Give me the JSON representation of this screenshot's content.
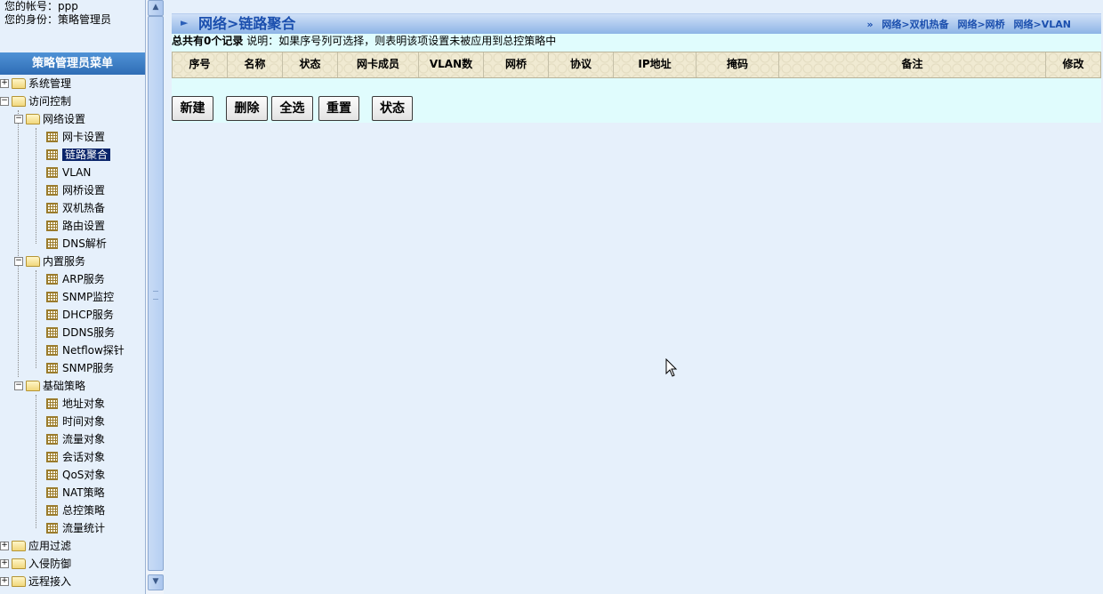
{
  "account": {
    "account_line": "您的帐号：ppp",
    "role_line": "您的身份：策略管理员"
  },
  "menu_title": "策略管理员菜单",
  "tree": {
    "system_mgmt": "系统管理",
    "access_control": "访问控制",
    "network_settings": "网络设置",
    "nic_settings": "网卡设置",
    "link_aggregation": "链路聚合",
    "vlan": "VLAN",
    "bridge_settings": "网桥设置",
    "dual_hot_standby": "双机热备",
    "route_settings": "路由设置",
    "dns": "DNS解析",
    "builtin_services": "内置服务",
    "arp": "ARP服务",
    "snmp_monitor": "SNMP监控",
    "dhcp": "DHCP服务",
    "ddns": "DDNS服务",
    "netflow": "Netflow探针",
    "snmp_service": "SNMP服务",
    "basic_policy": "基础策略",
    "address_object": "地址对象",
    "time_object": "时间对象",
    "traffic_object": "流量对象",
    "session_object": "会话对象",
    "qos_object": "QoS对象",
    "nat_policy": "NAT策略",
    "central_policy": "总控策略",
    "traffic_stats": "流量统计",
    "app_filter": "应用过滤",
    "intrusion_defense": "入侵防御",
    "remote_access": "远程接入"
  },
  "header": {
    "title": "网络>链路聚合",
    "links": [
      "网络>双机热备",
      "网络>网桥",
      "网络>VLAN"
    ],
    "link_prefix": "»"
  },
  "summary": {
    "count_text": "总共有0个记录",
    "note": "说明：如果序号列可选择，则表明该项设置未被应用到总控策略中"
  },
  "table": {
    "columns": [
      "序号",
      "名称",
      "状态",
      "网卡成员",
      "VLAN数",
      "网桥",
      "协议",
      "IP地址",
      "掩码",
      "备注",
      "修改"
    ],
    "rows": []
  },
  "actions": {
    "new": "新建",
    "delete": "删除",
    "select_all": "全选",
    "reset": "重置",
    "status": "状态"
  },
  "colors": {
    "title_blue": "#1b4fae",
    "menu_header": "#3a7cc4",
    "content_bg": "#e0fcfd",
    "page_bg": "#e6f0fb"
  }
}
